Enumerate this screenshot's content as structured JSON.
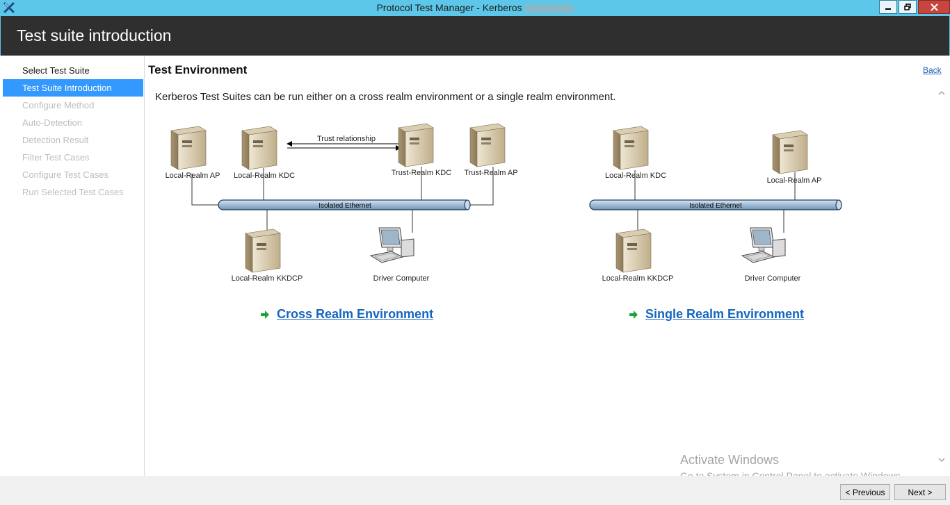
{
  "window": {
    "title": "Protocol Test Manager - Kerberos",
    "controls": [
      "minimize-icon",
      "restore-icon",
      "close-icon"
    ]
  },
  "header": {
    "title": "Test suite introduction"
  },
  "sidebar": {
    "items": [
      {
        "label": "Select Test Suite",
        "state": "normal"
      },
      {
        "label": "Test Suite Introduction",
        "state": "active"
      },
      {
        "label": "Configure Method",
        "state": "disabled"
      },
      {
        "label": "Auto-Detection",
        "state": "disabled"
      },
      {
        "label": "Detection Result",
        "state": "disabled"
      },
      {
        "label": "Filter Test Cases",
        "state": "disabled"
      },
      {
        "label": "Configure Test Cases",
        "state": "disabled"
      },
      {
        "label": "Run Selected Test Cases",
        "state": "disabled"
      }
    ]
  },
  "main": {
    "section_title": "Test Environment",
    "back_label": "Back",
    "intro": "Kerberos Test Suites can be run either on a cross realm environment or a single realm environment.",
    "cross_realm": {
      "link": "Cross Realm Environment",
      "trust_label": "Trust relationship",
      "network_label": "Isolated Ethernet",
      "nodes": {
        "local_ap": "Local-Realm AP",
        "local_kdc": "Local-Realm KDC",
        "trust_kdc": "Trust-Realm KDC",
        "trust_ap": "Trust-Realm AP",
        "kkdcp": "Local-Realm KKDCP",
        "driver": "Driver Computer"
      }
    },
    "single_realm": {
      "link": "Single Realm Environment",
      "network_label": "Isolated Ethernet",
      "nodes": {
        "local_kdc": "Local-Realm KDC",
        "local_ap": "Local-Realm AP",
        "kkdcp": "Local-Realm KKDCP",
        "driver": "Driver Computer"
      }
    }
  },
  "watermark": {
    "line1": "Activate Windows",
    "line2": "Go to System in Control Panel to activate Windows."
  },
  "footer": {
    "previous": "< Previous",
    "next": "Next >"
  },
  "colors": {
    "accent": "#5cc7e8",
    "header_bg": "#2f2f2f",
    "selection": "#3399ff",
    "link": "#1565c0",
    "arrow": "#1aa33a"
  }
}
